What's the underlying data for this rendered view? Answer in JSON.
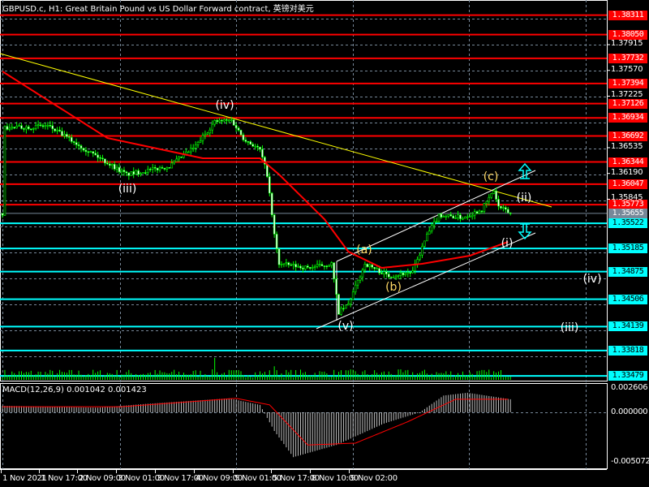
{
  "title": "GBPUSD.c, H1:  Great Britain Pound vs US Dollar Forward contract, 英镑对美元",
  "macd_title": "MACD(12,26,9) 0.001042 0.001423",
  "colors": {
    "background": "#000000",
    "bull": "#00ff00",
    "ma": "#ff0000",
    "resistance": "#ff0000",
    "support": "#00ffff",
    "trendline": "#ffff00",
    "wave_abc": "#ffd966",
    "current": "#778899"
  },
  "price_axis": [
    "1.37915",
    "1.37570",
    "1.37225",
    "1.36535",
    "1.36190",
    "1.35845"
  ],
  "resistance_levels": [
    "1.38311",
    "1.38050",
    "1.37732",
    "1.37394",
    "1.37126",
    "1.36934",
    "1.36692",
    "1.36344",
    "1.36047",
    "1.35773"
  ],
  "current_price": "1.35655",
  "support_levels": [
    "1.35522",
    "1.35185",
    "1.34875",
    "1.34506",
    "1.34139",
    "1.33818",
    "1.33479"
  ],
  "macd_axis": [
    "0.002606",
    "0.000000",
    "-0.005072"
  ],
  "time_axis": [
    "1 Nov 2021",
    "1 Nov 17:00",
    "2 Nov 09:00",
    "3 Nov 01:00",
    "3 Nov 17:00",
    "4 Nov 09:00",
    "5 Nov 01:00",
    "5 Nov 17:00",
    "8 Nov 10:00",
    "9 Nov 02:00"
  ],
  "wave_labels": [
    {
      "text": "(iv)",
      "kind": "white"
    },
    {
      "text": "(iii)",
      "kind": "white"
    },
    {
      "text": "(a)",
      "kind": "abc"
    },
    {
      "text": "(b)",
      "kind": "abc"
    },
    {
      "text": "(v)",
      "kind": "white"
    },
    {
      "text": "(c)",
      "kind": "abc"
    },
    {
      "text": "(ii)",
      "kind": "white"
    },
    {
      "text": "(i)",
      "kind": "white"
    },
    {
      "text": "(iv)",
      "kind": "white"
    },
    {
      "text": "(iii)",
      "kind": "white"
    }
  ],
  "chart_data": {
    "type": "candlestick",
    "symbol": "GBPUSD.c",
    "timeframe": "H1",
    "ylim": [
      1.3335,
      1.3835
    ],
    "price_path": [
      [
        1,
        1.36795
      ],
      [
        19,
        1.36828
      ],
      [
        41,
        1.36393
      ],
      [
        52,
        1.36176
      ],
      [
        70,
        1.36285
      ],
      [
        81,
        1.36556
      ],
      [
        89,
        1.36882
      ],
      [
        96,
        1.36904
      ],
      [
        101,
        1.36665
      ],
      [
        108,
        1.36502
      ],
      [
        111,
        1.36176
      ],
      [
        114,
        1.35361
      ],
      [
        116,
        1.3498
      ],
      [
        128,
        1.34926
      ],
      [
        138,
        1.3498
      ],
      [
        141,
        1.34328
      ],
      [
        145,
        1.34437
      ],
      [
        152,
        1.3498
      ],
      [
        162,
        1.34817
      ],
      [
        172,
        1.34872
      ],
      [
        178,
        1.35361
      ],
      [
        183,
        1.35633
      ],
      [
        193,
        1.356
      ],
      [
        201,
        1.35709
      ],
      [
        206,
        1.35959
      ],
      [
        208,
        1.35741
      ],
      [
        213,
        1.35655
      ]
    ],
    "moving_average": [
      [
        0,
        1.37556
      ],
      [
        44,
        1.36665
      ],
      [
        84,
        1.36393
      ],
      [
        108,
        1.36393
      ],
      [
        116,
        1.36176
      ],
      [
        135,
        1.35578
      ],
      [
        145,
        1.35143
      ],
      [
        159,
        1.34926
      ],
      [
        176,
        1.3498
      ],
      [
        196,
        1.35089
      ],
      [
        212,
        1.35274
      ]
    ],
    "macd_histogram": [
      [
        0,
        0.0007
      ],
      [
        40,
        0.0005
      ],
      [
        60,
        0.0009
      ],
      [
        95,
        0.0015
      ],
      [
        108,
        0.0008
      ],
      [
        114,
        -0.002
      ],
      [
        122,
        -0.0048
      ],
      [
        140,
        -0.0035
      ],
      [
        160,
        -0.0012
      ],
      [
        175,
        0.0
      ],
      [
        185,
        0.0018
      ],
      [
        195,
        0.0021
      ],
      [
        213,
        0.0014
      ]
    ],
    "macd_signal": [
      [
        0,
        0.0006
      ],
      [
        50,
        0.0006
      ],
      [
        98,
        0.0015
      ],
      [
        112,
        0.0008
      ],
      [
        128,
        -0.0035
      ],
      [
        148,
        -0.0033
      ],
      [
        170,
        -0.001
      ],
      [
        190,
        0.0014
      ],
      [
        213,
        0.0014
      ]
    ]
  }
}
